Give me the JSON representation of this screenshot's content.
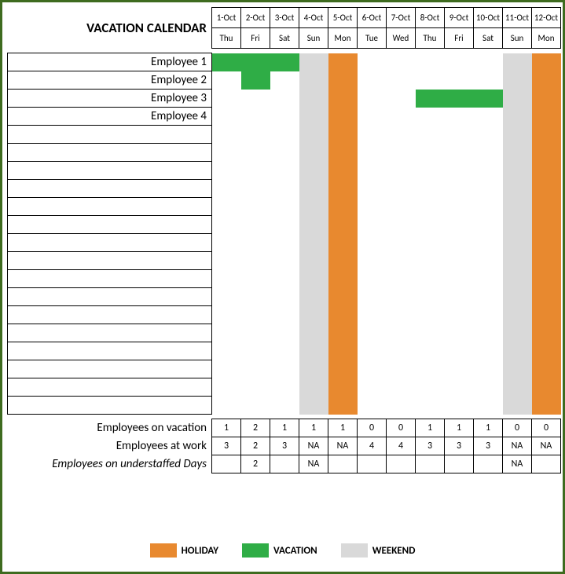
{
  "title": "VACATION CALENDAR",
  "colors": {
    "holiday": "#e8892f",
    "vacation": "#2fad46",
    "weekend": "#d9d9d9"
  },
  "dates": [
    "1-Oct",
    "2-Oct",
    "3-Oct",
    "4-Oct",
    "5-Oct",
    "6-Oct",
    "7-Oct",
    "8-Oct",
    "9-Oct",
    "10-Oct",
    "11-Oct",
    "12-Oct"
  ],
  "dows": [
    "Thu",
    "Fri",
    "Sat",
    "Sun",
    "Mon",
    "Tue",
    "Wed",
    "Thu",
    "Fri",
    "Sat",
    "Sun",
    "Mon"
  ],
  "day_type": [
    "",
    "",
    "",
    "weekend",
    "holiday",
    "",
    "",
    "",
    "",
    "",
    "weekend",
    "holiday"
  ],
  "employees": [
    {
      "name": "Employee 1",
      "vac": [
        true,
        true,
        true,
        false,
        false,
        false,
        false,
        false,
        false,
        false,
        false,
        false
      ]
    },
    {
      "name": "Employee 2",
      "vac": [
        false,
        true,
        false,
        false,
        false,
        false,
        false,
        false,
        false,
        false,
        false,
        false
      ]
    },
    {
      "name": "Employee 3",
      "vac": [
        false,
        false,
        false,
        false,
        false,
        false,
        false,
        true,
        true,
        true,
        false,
        false
      ]
    },
    {
      "name": "Employee 4",
      "vac": [
        false,
        false,
        false,
        false,
        false,
        false,
        false,
        false,
        false,
        false,
        false,
        false
      ]
    }
  ],
  "empty_rows": 16,
  "summary": [
    {
      "label": "Employees on vacation",
      "italic": false,
      "values": [
        "1",
        "2",
        "1",
        "1",
        "1",
        "0",
        "0",
        "1",
        "1",
        "1",
        "0",
        "0"
      ]
    },
    {
      "label": "Employees at work",
      "italic": false,
      "values": [
        "3",
        "2",
        "3",
        "NA",
        "NA",
        "4",
        "4",
        "3",
        "3",
        "3",
        "NA",
        "NA"
      ]
    },
    {
      "label": "Employees on understaffed Days",
      "italic": true,
      "values": [
        "",
        "2",
        "",
        "NA",
        "",
        "",
        "",
        "",
        "",
        "",
        "NA",
        ""
      ]
    }
  ],
  "legend": [
    {
      "label": "HOLIDAY",
      "swatch": "holiday"
    },
    {
      "label": "VACATION",
      "swatch": "vacation"
    },
    {
      "label": "WEEKEND",
      "swatch": "weekend"
    }
  ],
  "chart_data": {
    "type": "table",
    "title": "VACATION CALENDAR",
    "x": [
      "1-Oct",
      "2-Oct",
      "3-Oct",
      "4-Oct",
      "5-Oct",
      "6-Oct",
      "7-Oct",
      "8-Oct",
      "9-Oct",
      "10-Oct",
      "11-Oct",
      "12-Oct"
    ],
    "day_of_week": [
      "Thu",
      "Fri",
      "Sat",
      "Sun",
      "Mon",
      "Tue",
      "Wed",
      "Thu",
      "Fri",
      "Sat",
      "Sun",
      "Mon"
    ],
    "day_class": [
      "work",
      "work",
      "work",
      "weekend",
      "holiday",
      "work",
      "work",
      "work",
      "work",
      "work",
      "weekend",
      "holiday"
    ],
    "series": [
      {
        "name": "Employee 1",
        "values": [
          1,
          1,
          1,
          0,
          0,
          0,
          0,
          0,
          0,
          0,
          0,
          0
        ]
      },
      {
        "name": "Employee 2",
        "values": [
          0,
          1,
          0,
          0,
          0,
          0,
          0,
          0,
          0,
          0,
          0,
          0
        ]
      },
      {
        "name": "Employee 3",
        "values": [
          0,
          0,
          0,
          0,
          0,
          0,
          0,
          1,
          1,
          1,
          0,
          0
        ]
      },
      {
        "name": "Employee 4",
        "values": [
          0,
          0,
          0,
          0,
          0,
          0,
          0,
          0,
          0,
          0,
          0,
          0
        ]
      }
    ],
    "summary": {
      "employees_on_vacation": [
        1,
        2,
        1,
        1,
        1,
        0,
        0,
        1,
        1,
        1,
        0,
        0
      ],
      "employees_at_work": [
        3,
        2,
        3,
        "NA",
        "NA",
        4,
        4,
        3,
        3,
        3,
        "NA",
        "NA"
      ],
      "employees_on_understaffed_days": [
        "",
        2,
        "",
        "NA",
        "",
        "",
        "",
        "",
        "",
        "",
        "NA",
        ""
      ]
    }
  }
}
